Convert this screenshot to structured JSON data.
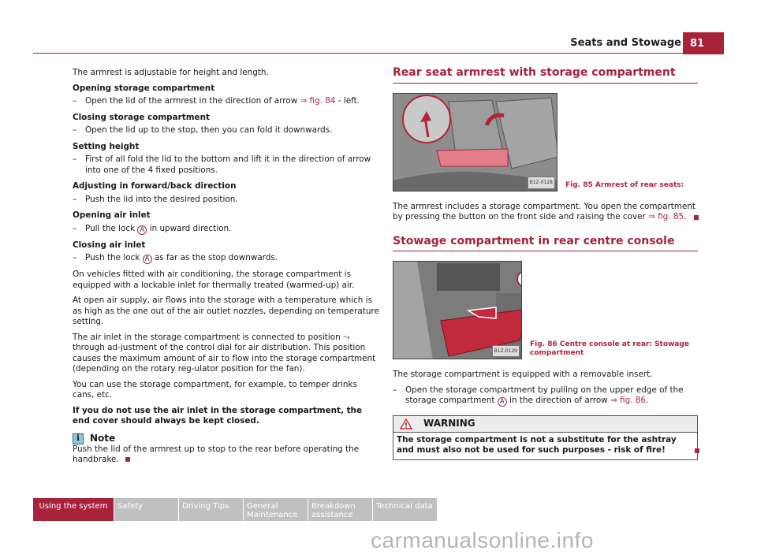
{
  "header": {
    "section_title": "Seats and Stowage",
    "page_number": "81"
  },
  "left": {
    "intro": "The armrest is adjustable for height and length.",
    "sections": [
      {
        "heading": "Opening storage compartment",
        "step_pre": "Open the lid of the armrest in the direction of arrow ",
        "step_link": "⇒ fig. 84",
        "step_post": " - left."
      },
      {
        "heading": "Closing storage compartment",
        "step": "Open the lid up to the stop, then you can fold it downwards."
      },
      {
        "heading": "Setting height",
        "step": "First of all fold the lid to the bottom and lift it in the direction of arrow into one of the 4 fixed positions."
      },
      {
        "heading": "Adjusting in forward/back direction",
        "step": "Push the lid into the desired position."
      },
      {
        "heading": "Opening air inlet",
        "step_pre": "Pull the lock ",
        "marker": "A",
        "step_post": " in upward direction."
      },
      {
        "heading": "Closing air inlet",
        "step_pre": "Push the lock ",
        "marker": "A",
        "step_post": " as far as the stop downwards."
      }
    ],
    "paragraphs": [
      "On vehicles fitted with air conditioning, the storage compartment is equipped with a lockable inlet for thermally treated (warmed-up) air.",
      "At open air supply, air flows into the storage with a temperature which is as high as the one out of the air outlet nozzles, depending on temperature setting.",
      "The air inlet in the storage compartment is connected to position ⤳ through ad-justment of the control dial for air distribution. This position causes the maximum amount of air to flow into the storage compartment (depending on the rotary reg-ulator position for the fan).",
      "You can use the storage compartment, for example, to temper drinks cans, etc."
    ],
    "bold_paragraph": "If you do not use the air inlet in the storage compartment, the end cover should always be kept closed.",
    "note": {
      "title": "Note",
      "icon": "info-icon",
      "text": "Push the lid of the armrest up to stop to the rear before operating the handbrake."
    }
  },
  "right": {
    "section1": {
      "title": "Rear seat armrest with storage compartment",
      "figure_code": "B1Z-0128",
      "caption": "Fig. 85   Armrest of rear seats:",
      "text_pre": "The armrest includes a storage compartment. You open the compartment by pressing the button on the front side and raising the cover ",
      "text_link": "⇒ fig. 85",
      "text_post": "."
    },
    "section2": {
      "title": "Stowage compartment in rear centre console",
      "figure_code": "B1Z-0129",
      "figure_marker": "A",
      "caption": "Fig. 86   Centre console at rear: Stowage compartment",
      "intro": "The storage compartment is equipped with a removable insert.",
      "step_pre": "Open the storage compartment by pulling on the upper edge of the storage compartment ",
      "marker": "A",
      "step_mid": " in the direction of arrow ",
      "step_link": "⇒ fig. 86",
      "step_post": "."
    },
    "warning": {
      "title": "WARNING",
      "icon": "warning-triangle-icon",
      "text": "The storage compartment is not a substitute for the ashtray and must also not be used for such purposes - risk of fire!"
    }
  },
  "footer": {
    "tabs": [
      "Using the system",
      "Safety",
      "Driving Tips",
      "General Maintenance",
      "Breakdown assistance",
      "Technical data"
    ],
    "active_tab": "Using the system"
  },
  "watermark": "carmanualsonline.info",
  "colors": {
    "accent": "#a8223a",
    "tab_inactive": "#c0c0c0"
  }
}
